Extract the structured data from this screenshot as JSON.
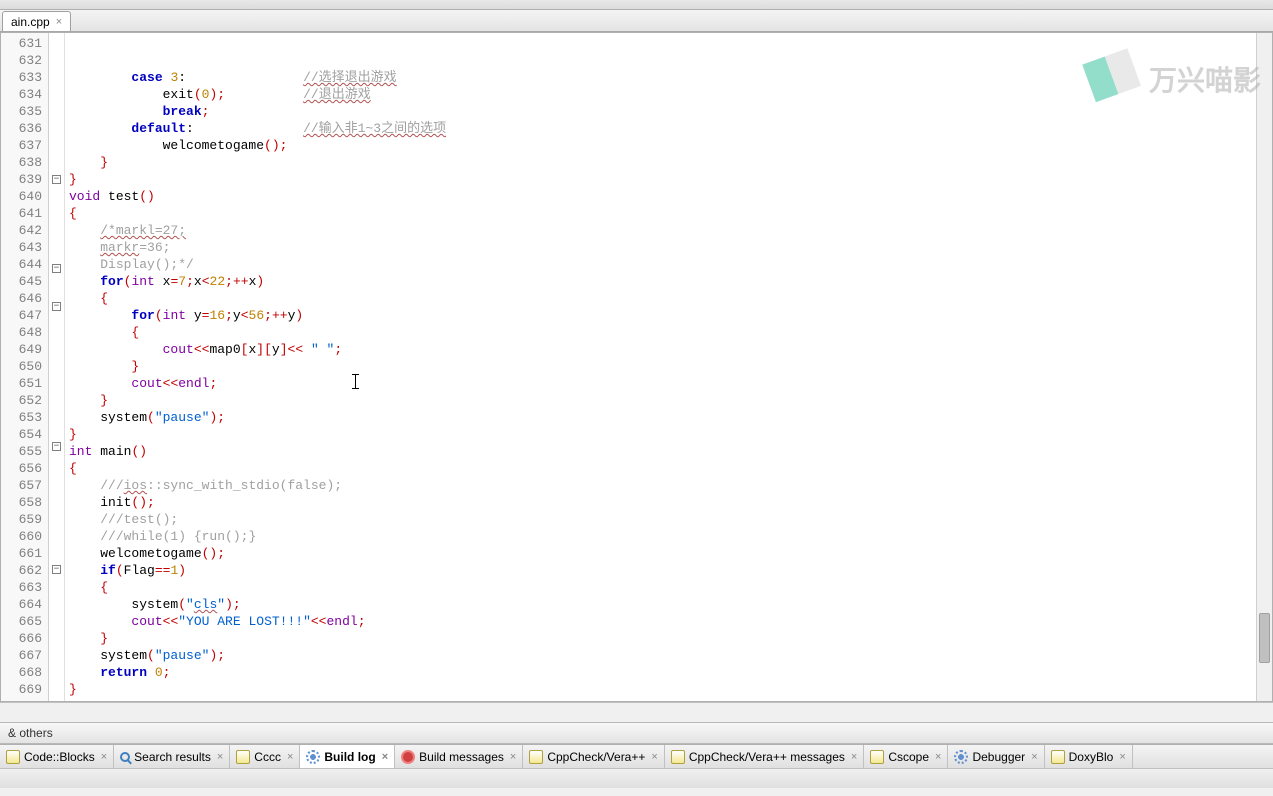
{
  "file_tab": {
    "name": "ain.cpp"
  },
  "panel_title": "& others",
  "watermark_text": "万兴喵影",
  "line_numbers": [
    631,
    632,
    633,
    634,
    635,
    636,
    637,
    638,
    639,
    640,
    641,
    642,
    643,
    644,
    645,
    646,
    647,
    648,
    649,
    650,
    651,
    652,
    653,
    654,
    655,
    656,
    657,
    658,
    659,
    660,
    661,
    662,
    663,
    664,
    665,
    666,
    667,
    668,
    669
  ],
  "code_lines": [
    {
      "indent": 8,
      "tokens": [
        {
          "t": "case ",
          "c": "kw"
        },
        {
          "t": "3",
          "c": "num"
        },
        {
          "t": ":"
        }
      ],
      "comment": "//选择退出游戏",
      "wavy_comment": true
    },
    {
      "indent": 12,
      "tokens": [
        {
          "t": "exit"
        },
        {
          "t": "(",
          "c": "op"
        },
        {
          "t": "0",
          "c": "num"
        },
        {
          "t": ")",
          "c": "op"
        },
        {
          "t": ";",
          "c": "op"
        }
      ],
      "comment": "//退出游戏",
      "wavy_comment": true
    },
    {
      "indent": 12,
      "tokens": [
        {
          "t": "break",
          "c": "kw"
        },
        {
          "t": ";",
          "c": "op"
        }
      ]
    },
    {
      "indent": 8,
      "tokens": [
        {
          "t": "default",
          "c": "kw"
        },
        {
          "t": ":"
        }
      ],
      "comment": "//输入非1~3之间的选项",
      "wavy_comment": true
    },
    {
      "indent": 12,
      "tokens": [
        {
          "t": "welcometogame"
        },
        {
          "t": "()",
          "c": "op"
        },
        {
          "t": ";",
          "c": "op"
        }
      ]
    },
    {
      "indent": 4,
      "tokens": [
        {
          "t": "}",
          "c": "op"
        }
      ]
    },
    {
      "indent": 0,
      "tokens": [
        {
          "t": "}",
          "c": "op"
        }
      ]
    },
    {
      "indent": 0,
      "tokens": [
        {
          "t": "void ",
          "c": "kw2"
        },
        {
          "t": "test"
        },
        {
          "t": "()",
          "c": "op"
        }
      ]
    },
    {
      "indent": 0,
      "tokens": [
        {
          "t": "{",
          "c": "op"
        }
      ],
      "fold": "-"
    },
    {
      "indent": 4,
      "tokens": [
        {
          "t": "/*markl=27;",
          "c": "cm-wavy"
        }
      ]
    },
    {
      "indent": 4,
      "tokens": [
        {
          "t": "markr",
          "c": "cm-wavy"
        },
        {
          "t": "=36;",
          "c": "cm"
        }
      ]
    },
    {
      "indent": 4,
      "tokens": [
        {
          "t": "Display();*/",
          "c": "cm"
        }
      ]
    },
    {
      "indent": 4,
      "tokens": [
        {
          "t": "for",
          "c": "kw"
        },
        {
          "t": "(",
          "c": "op"
        },
        {
          "t": "int ",
          "c": "kw2"
        },
        {
          "t": "x"
        },
        {
          "t": "=",
          "c": "op"
        },
        {
          "t": "7",
          "c": "num"
        },
        {
          "t": ";",
          "c": "op"
        },
        {
          "t": "x"
        },
        {
          "t": "<",
          "c": "op"
        },
        {
          "t": "22",
          "c": "num"
        },
        {
          "t": ";",
          "c": "op"
        },
        {
          "t": "++",
          "c": "op"
        },
        {
          "t": "x"
        },
        {
          "t": ")",
          "c": "op"
        }
      ]
    },
    {
      "indent": 4,
      "tokens": [
        {
          "t": "{",
          "c": "op"
        }
      ],
      "fold": "-"
    },
    {
      "indent": 8,
      "tokens": [
        {
          "t": "for",
          "c": "kw"
        },
        {
          "t": "(",
          "c": "op"
        },
        {
          "t": "int ",
          "c": "kw2"
        },
        {
          "t": "y"
        },
        {
          "t": "=",
          "c": "op"
        },
        {
          "t": "16",
          "c": "num"
        },
        {
          "t": ";",
          "c": "op"
        },
        {
          "t": "y"
        },
        {
          "t": "<",
          "c": "op"
        },
        {
          "t": "56",
          "c": "num"
        },
        {
          "t": ";",
          "c": "op"
        },
        {
          "t": "++",
          "c": "op"
        },
        {
          "t": "y"
        },
        {
          "t": ")",
          "c": "op"
        }
      ]
    },
    {
      "indent": 8,
      "tokens": [
        {
          "t": "{",
          "c": "op"
        }
      ],
      "fold": "-"
    },
    {
      "indent": 12,
      "tokens": [
        {
          "t": "cout",
          "c": "kw2"
        },
        {
          "t": "<<",
          "c": "op"
        },
        {
          "t": "map0"
        },
        {
          "t": "[",
          "c": "op"
        },
        {
          "t": "x"
        },
        {
          "t": "][",
          "c": "op"
        },
        {
          "t": "y"
        },
        {
          "t": "]",
          "c": "op"
        },
        {
          "t": "<< ",
          "c": "op"
        },
        {
          "t": "\" \"",
          "c": "str"
        },
        {
          "t": ";",
          "c": "op"
        }
      ]
    },
    {
      "indent": 8,
      "tokens": [
        {
          "t": "}",
          "c": "op"
        }
      ]
    },
    {
      "indent": 8,
      "tokens": [
        {
          "t": "cout",
          "c": "kw2"
        },
        {
          "t": "<<",
          "c": "op"
        },
        {
          "t": "endl",
          "c": "kw2"
        },
        {
          "t": ";",
          "c": "op"
        }
      ]
    },
    {
      "indent": 4,
      "tokens": [
        {
          "t": "}",
          "c": "op"
        }
      ]
    },
    {
      "indent": 4,
      "tokens": [
        {
          "t": "system"
        },
        {
          "t": "(",
          "c": "op"
        },
        {
          "t": "\"pause\"",
          "c": "str"
        },
        {
          "t": ")",
          "c": "op"
        },
        {
          "t": ";",
          "c": "op"
        }
      ]
    },
    {
      "indent": 0,
      "tokens": [
        {
          "t": "}",
          "c": "op"
        }
      ]
    },
    {
      "indent": 0,
      "tokens": [
        {
          "t": "int ",
          "c": "kw2"
        },
        {
          "t": "main"
        },
        {
          "t": "()",
          "c": "op"
        }
      ]
    },
    {
      "indent": 0,
      "tokens": [
        {
          "t": "{",
          "c": "op"
        }
      ],
      "fold": "-"
    },
    {
      "indent": 4,
      "tokens": [
        {
          "t": "///",
          "c": "cm"
        },
        {
          "t": "ios",
          "c": "cm-wavy"
        },
        {
          "t": "::sync_with_stdio(false);",
          "c": "cm"
        }
      ]
    },
    {
      "indent": 4,
      "tokens": [
        {
          "t": "init"
        },
        {
          "t": "()",
          "c": "op"
        },
        {
          "t": ";",
          "c": "op"
        }
      ]
    },
    {
      "indent": 4,
      "tokens": [
        {
          "t": "///test();",
          "c": "cm"
        }
      ]
    },
    {
      "indent": 4,
      "tokens": [
        {
          "t": "///while(1) {run();}",
          "c": "cm"
        }
      ]
    },
    {
      "indent": 4,
      "tokens": [
        {
          "t": "welcometogame"
        },
        {
          "t": "()",
          "c": "op"
        },
        {
          "t": ";",
          "c": "op"
        }
      ]
    },
    {
      "indent": 4,
      "tokens": [
        {
          "t": "if",
          "c": "kw"
        },
        {
          "t": "(",
          "c": "op"
        },
        {
          "t": "Flag"
        },
        {
          "t": "==",
          "c": "op"
        },
        {
          "t": "1",
          "c": "num"
        },
        {
          "t": ")",
          "c": "op"
        }
      ]
    },
    {
      "indent": 4,
      "tokens": [
        {
          "t": "{",
          "c": "op"
        }
      ],
      "fold": "-"
    },
    {
      "indent": 8,
      "tokens": [
        {
          "t": "system"
        },
        {
          "t": "(",
          "c": "op"
        },
        {
          "t": "\"",
          "c": "str"
        },
        {
          "t": "cls",
          "c": "str",
          "wavy": true
        },
        {
          "t": "\"",
          "c": "str"
        },
        {
          "t": ")",
          "c": "op"
        },
        {
          "t": ";",
          "c": "op"
        }
      ]
    },
    {
      "indent": 8,
      "tokens": [
        {
          "t": "cout",
          "c": "kw2"
        },
        {
          "t": "<<",
          "c": "op"
        },
        {
          "t": "\"YOU ARE LOST!!!\"",
          "c": "str"
        },
        {
          "t": "<<",
          "c": "op"
        },
        {
          "t": "endl",
          "c": "kw2"
        },
        {
          "t": ";",
          "c": "op"
        }
      ]
    },
    {
      "indent": 4,
      "tokens": [
        {
          "t": "}",
          "c": "op"
        }
      ]
    },
    {
      "indent": 4,
      "tokens": [
        {
          "t": "system"
        },
        {
          "t": "(",
          "c": "op"
        },
        {
          "t": "\"pause\"",
          "c": "str"
        },
        {
          "t": ")",
          "c": "op"
        },
        {
          "t": ";",
          "c": "op"
        }
      ]
    },
    {
      "indent": 4,
      "tokens": [
        {
          "t": "return ",
          "c": "kw"
        },
        {
          "t": "0",
          "c": "num"
        },
        {
          "t": ";",
          "c": "op"
        }
      ]
    },
    {
      "indent": 0,
      "tokens": [
        {
          "t": "}",
          "c": "op"
        }
      ]
    },
    {
      "indent": 0,
      "tokens": []
    },
    {
      "indent": 0,
      "tokens": []
    }
  ],
  "bottom_tabs": [
    {
      "label": "Code::Blocks",
      "icon": "doc",
      "active": false
    },
    {
      "label": "Search results",
      "icon": "search",
      "active": false
    },
    {
      "label": "Cccc",
      "icon": "doc",
      "active": false
    },
    {
      "label": "Build log",
      "icon": "gear",
      "active": true
    },
    {
      "label": "Build messages",
      "icon": "red",
      "active": false
    },
    {
      "label": "CppCheck/Vera++",
      "icon": "doc",
      "active": false
    },
    {
      "label": "CppCheck/Vera++ messages",
      "icon": "doc",
      "active": false
    },
    {
      "label": "Cscope",
      "icon": "doc",
      "active": false
    },
    {
      "label": "Debugger",
      "icon": "gear",
      "active": false
    },
    {
      "label": "DoxyBlo",
      "icon": "doc",
      "active": false
    }
  ]
}
